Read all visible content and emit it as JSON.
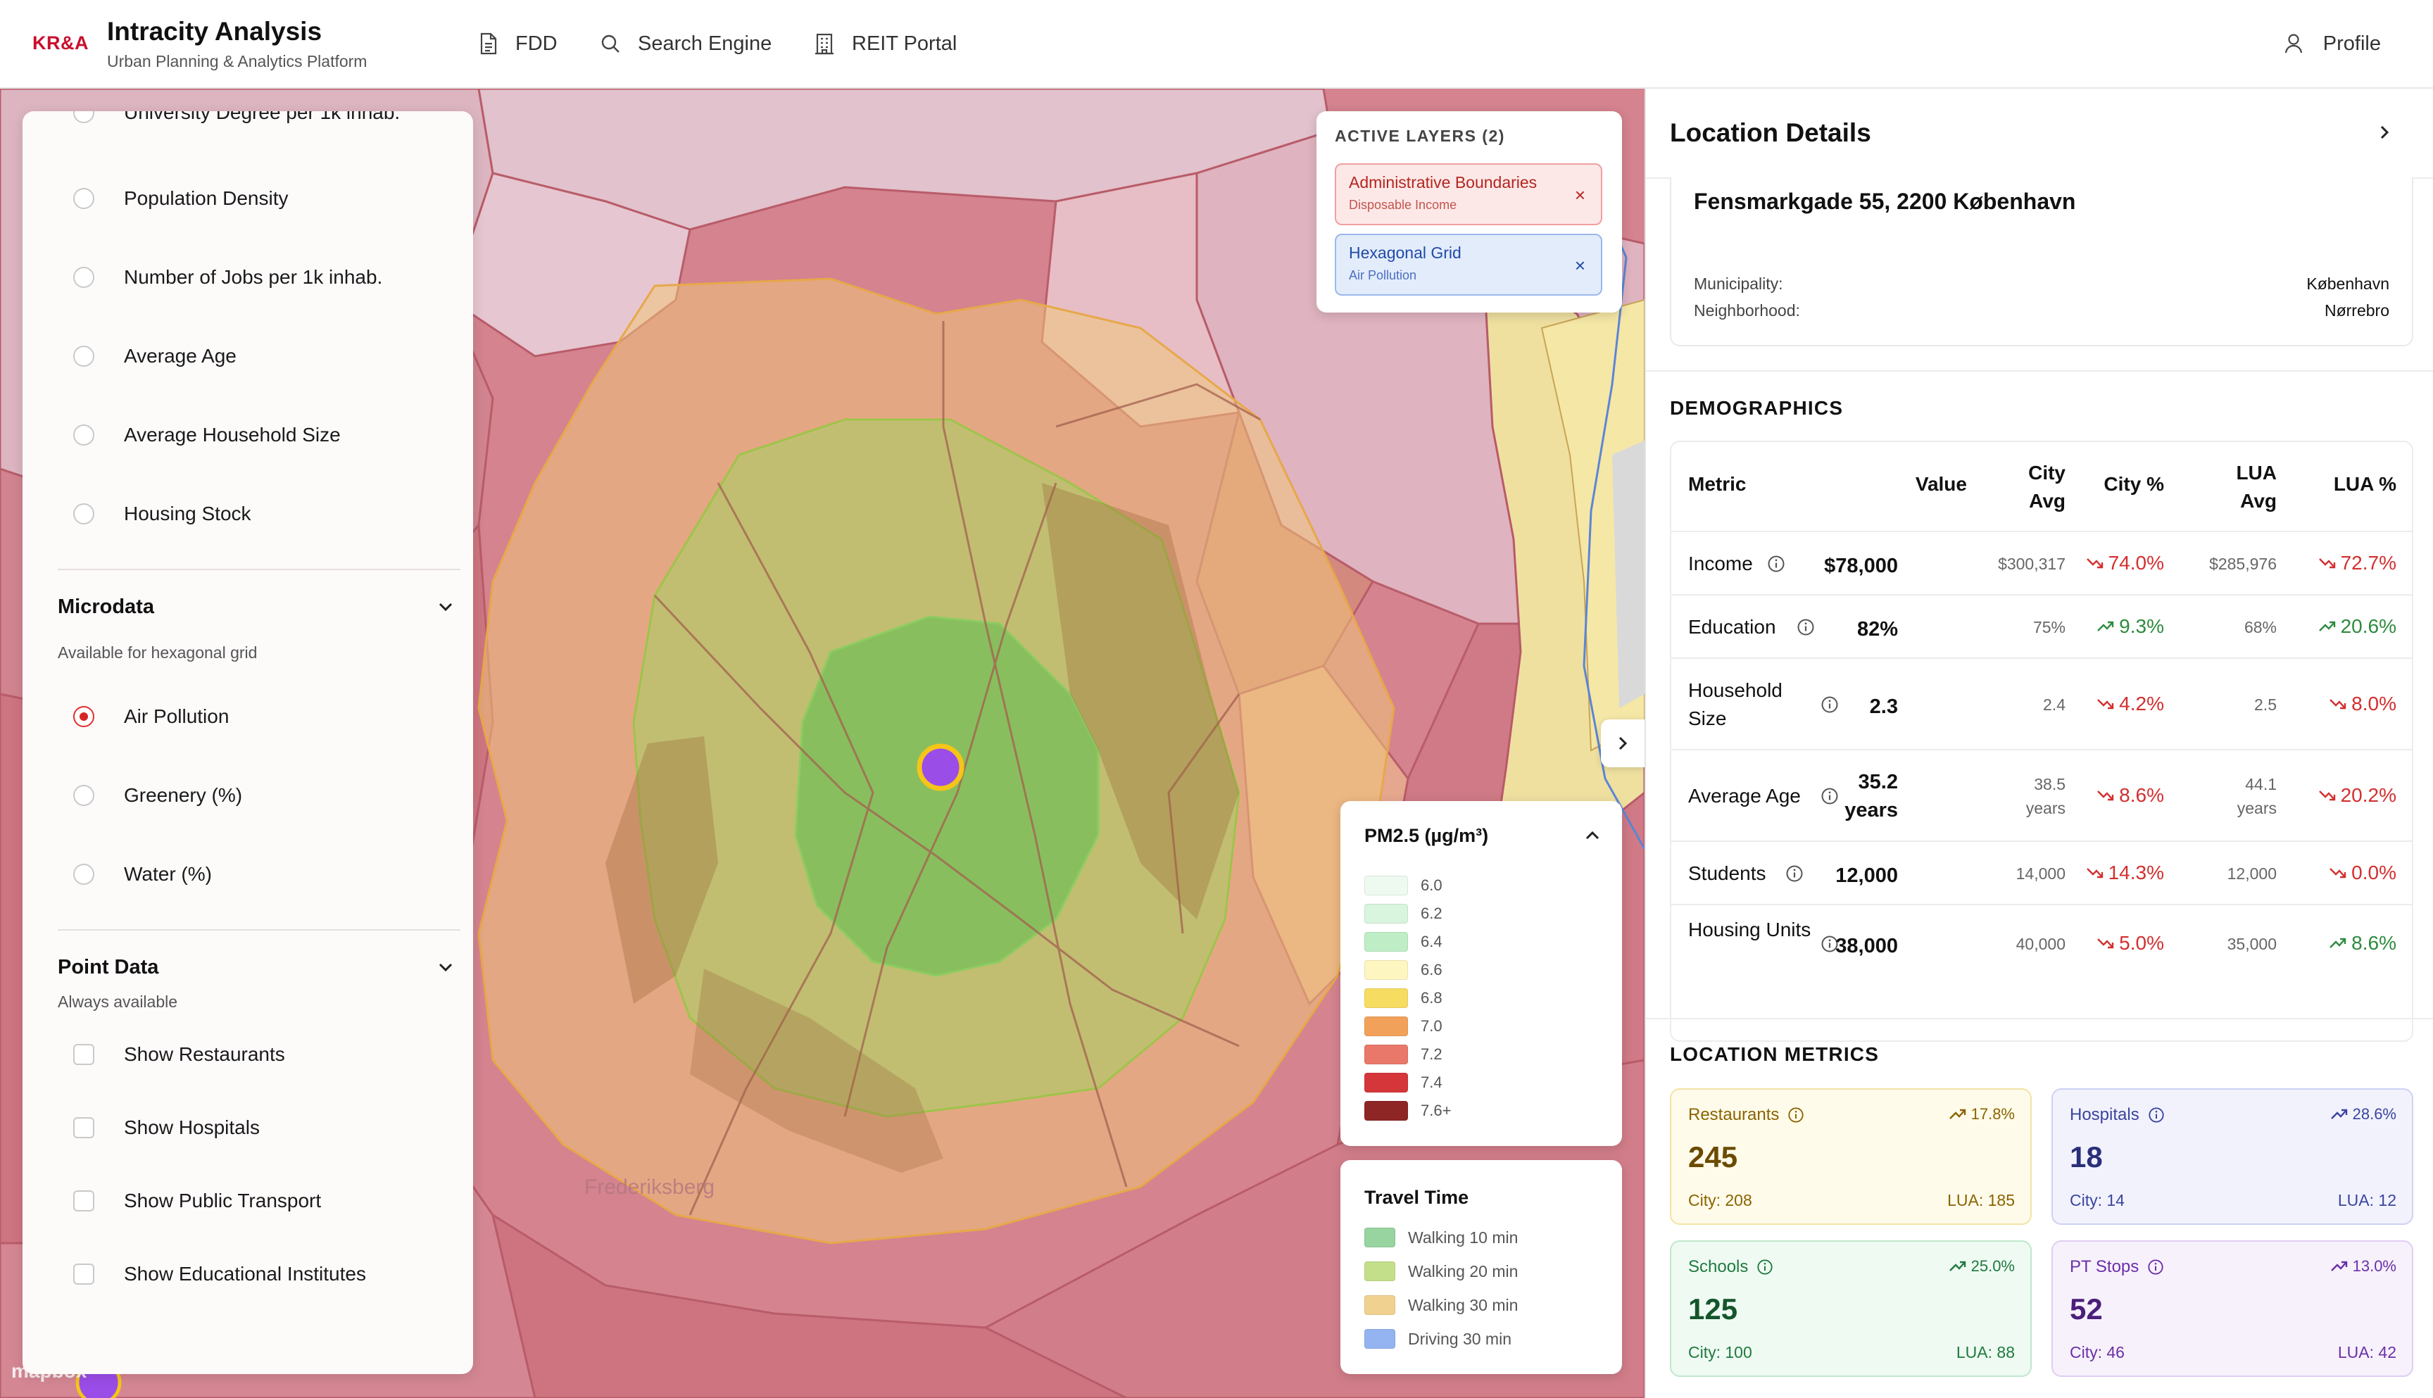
{
  "header": {
    "logo": "KR&A",
    "title": "Intracity Analysis",
    "subtitle": "Urban Planning & Analytics Platform",
    "nav": [
      {
        "label": "FDD",
        "icon": "document-icon"
      },
      {
        "label": "Search Engine",
        "icon": "search-icon"
      },
      {
        "label": "REIT Portal",
        "icon": "building-icon"
      }
    ],
    "profile_label": "Profile"
  },
  "left_panel": {
    "layers": [
      {
        "label": "University Degree per 1k inhab.",
        "selected": false
      },
      {
        "label": "Population Density",
        "selected": false
      },
      {
        "label": "Number of Jobs per 1k inhab.",
        "selected": false
      },
      {
        "label": "Average Age",
        "selected": false
      },
      {
        "label": "Average Household Size",
        "selected": false
      },
      {
        "label": "Housing Stock",
        "selected": false
      }
    ],
    "microdata": {
      "title": "Microdata",
      "subtitle": "Available for hexagonal grid",
      "options": [
        {
          "label": "Air Pollution",
          "selected": true
        },
        {
          "label": "Greenery (%)",
          "selected": false
        },
        {
          "label": "Water (%)",
          "selected": false
        }
      ]
    },
    "point_data": {
      "title": "Point Data",
      "subtitle": "Always available",
      "options": [
        {
          "label": "Show Restaurants"
        },
        {
          "label": "Show Hospitals"
        },
        {
          "label": "Show Public Transport"
        },
        {
          "label": "Show Educational Institutes"
        }
      ]
    }
  },
  "active_layers": {
    "title": "ACTIVE LAYERS (2)",
    "items": [
      {
        "name": "Administrative Boundaries",
        "sub": "Disposable Income"
      },
      {
        "name": "Hexagonal Grid",
        "sub": "Air Pollution"
      }
    ],
    "remove_glyph": "×"
  },
  "legend": {
    "title": "PM2.5 (µg/m³)",
    "items": [
      {
        "label": "6.0",
        "color": "#eefaf0"
      },
      {
        "label": "6.2",
        "color": "#d9f5dd"
      },
      {
        "label": "6.4",
        "color": "#bfeec6"
      },
      {
        "label": "6.6",
        "color": "#fdf6c0"
      },
      {
        "label": "6.8",
        "color": "#f7dc62"
      },
      {
        "label": "7.0",
        "color": "#f2a15a"
      },
      {
        "label": "7.2",
        "color": "#e9786a"
      },
      {
        "label": "7.4",
        "color": "#d4363a"
      },
      {
        "label": "7.6+",
        "color": "#8e2626"
      }
    ]
  },
  "travel_time": {
    "title": "Travel Time",
    "items": [
      {
        "label": "Walking 10 min",
        "color": "#97d4a0"
      },
      {
        "label": "Walking 20 min",
        "color": "#c3df8a"
      },
      {
        "label": "Walking 30 min",
        "color": "#f0d18f"
      },
      {
        "label": "Driving 30 min",
        "color": "#93b4f0"
      }
    ]
  },
  "map": {
    "attribution": "mapbox",
    "place_labels": [
      "Frederiksberg"
    ]
  },
  "details": {
    "title": "Location Details",
    "address": "Fensmarkgade 55, 2200 København",
    "municipality_label": "Municipality:",
    "municipality_value": "København",
    "neighborhood_label": "Neighborhood:",
    "neighborhood_value": "Nørrebro",
    "demographics_title": "DEMOGRAPHICS",
    "table_headers": {
      "metric": "Metric",
      "value": "Value",
      "city_avg": "City Avg",
      "city_pct": "City %",
      "lua_avg": "LUA Avg",
      "lua_pct": "LUA %"
    },
    "rows": [
      {
        "metric": "Income",
        "value": "$78,000",
        "city_avg": "$300,317",
        "city_pct": "74.0%",
        "city_dir": "down",
        "lua_avg": "$285,976",
        "lua_pct": "72.7%",
        "lua_dir": "down"
      },
      {
        "metric": "Education",
        "value": "82%",
        "city_avg": "75%",
        "city_pct": "9.3%",
        "city_dir": "up",
        "lua_avg": "68%",
        "lua_pct": "20.6%",
        "lua_dir": "up"
      },
      {
        "metric": "Household Size",
        "value": "2.3",
        "city_avg": "2.4",
        "city_pct": "4.2%",
        "city_dir": "down",
        "lua_avg": "2.5",
        "lua_pct": "8.0%",
        "lua_dir": "down"
      },
      {
        "metric": "Average Age",
        "value": "35.2 years",
        "city_avg": "38.5 years",
        "city_pct": "8.6%",
        "city_dir": "down",
        "lua_avg": "44.1 years",
        "lua_pct": "20.2%",
        "lua_dir": "down"
      },
      {
        "metric": "Students",
        "value": "12,000",
        "city_avg": "14,000",
        "city_pct": "14.3%",
        "city_dir": "down",
        "lua_avg": "12,000",
        "lua_pct": "0.0%",
        "lua_dir": "down"
      },
      {
        "metric": "Housing Units",
        "value": "38,000",
        "city_avg": "40,000",
        "city_pct": "5.0%",
        "city_dir": "down",
        "lua_avg": "35,000",
        "lua_pct": "8.6%",
        "lua_dir": "up"
      }
    ],
    "location_metrics_title": "LOCATION METRICS",
    "cards": [
      {
        "label": "Restaurants",
        "trend": "17.8%",
        "value": "245",
        "city": "City: 208",
        "lua": "LUA: 185",
        "bg": "#fffbea",
        "border": "#f3e3a6",
        "fg": "#8a6400",
        "value_fg": "#6b4b00"
      },
      {
        "label": "Hospitals",
        "trend": "28.6%",
        "value": "18",
        "city": "City: 14",
        "lua": "LUA: 12",
        "bg": "#f1f2fc",
        "border": "#cdd2f4",
        "fg": "#3b44a0",
        "value_fg": "#2a2f7a"
      },
      {
        "label": "Schools",
        "trend": "25.0%",
        "value": "125",
        "city": "City: 100",
        "lua": "LUA: 88",
        "bg": "#effaf3",
        "border": "#bfe8cc",
        "fg": "#1f7a3e",
        "value_fg": "#14562b"
      },
      {
        "label": "PT Stops",
        "trend": "13.0%",
        "value": "52",
        "city": "City: 46",
        "lua": "LUA: 42",
        "bg": "#f7f1fc",
        "border": "#e0cdf4",
        "fg": "#6b2fa8",
        "value_fg": "#4b1f7a"
      }
    ]
  },
  "colors": {
    "accent_red": "#c8102e",
    "trend_up": "#2e8b3e",
    "trend_down": "#d32f2f",
    "marker": "#9b4de8",
    "marker_ring": "#f5c518"
  }
}
